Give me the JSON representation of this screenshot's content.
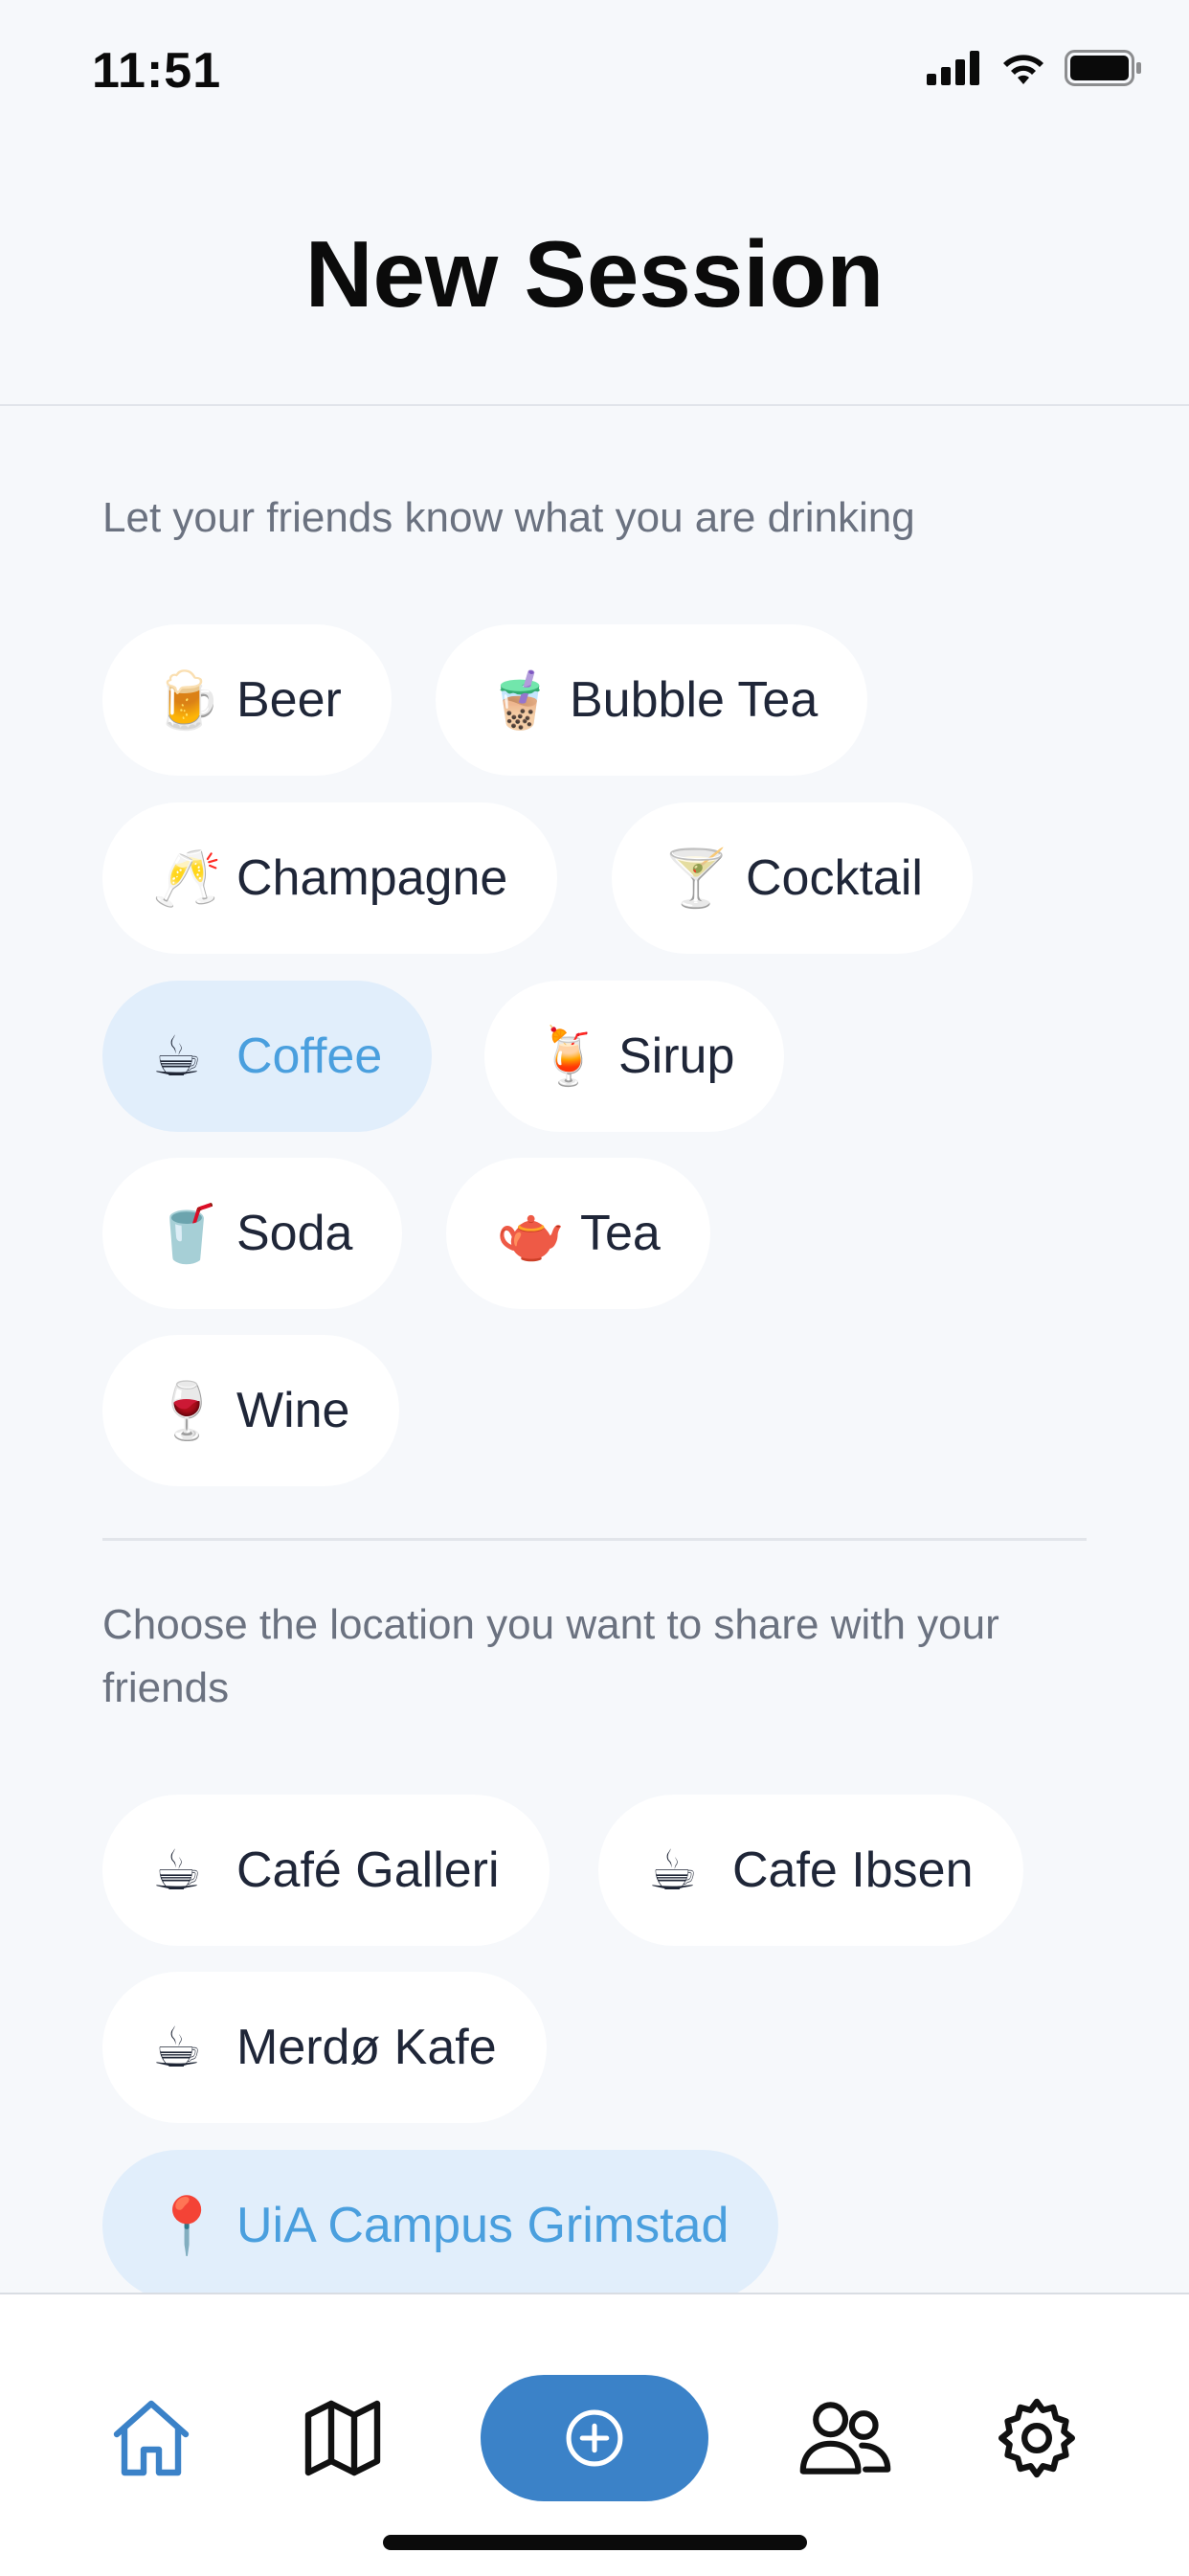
{
  "status": {
    "time": "11:51"
  },
  "header": {
    "title": "New Session"
  },
  "drinks": {
    "prompt": "Let your friends know what you are drinking",
    "items": [
      {
        "label": "Beer",
        "emoji": "🍺",
        "selected": false
      },
      {
        "label": "Bubble Tea",
        "emoji": "🧋",
        "selected": false
      },
      {
        "label": "Champagne",
        "emoji": "🥂",
        "selected": false
      },
      {
        "label": "Cocktail",
        "emoji": "🍸",
        "selected": false
      },
      {
        "label": "Coffee",
        "emoji": "☕",
        "selected": true
      },
      {
        "label": "Sirup",
        "emoji": "🍹",
        "selected": false
      },
      {
        "label": "Soda",
        "emoji": "🥤",
        "selected": false
      },
      {
        "label": "Tea",
        "emoji": "🫖",
        "selected": false
      },
      {
        "label": "Wine",
        "emoji": "🍷",
        "selected": false
      }
    ]
  },
  "locations": {
    "prompt": "Choose the location you want to share with your friends",
    "items": [
      {
        "label": "Café Galleri",
        "emoji": "☕",
        "selected": false
      },
      {
        "label": "Cafe Ibsen",
        "emoji": "☕",
        "selected": false
      },
      {
        "label": "Merdø Kafe",
        "emoji": "☕",
        "selected": false
      },
      {
        "label": "UiA Campus Grimstad",
        "emoji": "📍",
        "selected": true
      }
    ]
  },
  "tabbar": {
    "items": [
      "home-icon",
      "map-icon",
      "add-circle-icon",
      "friends-icon",
      "settings-icon"
    ],
    "active": "home-icon"
  },
  "colors": {
    "accent": "#3b82c8",
    "selected_bg": "#e1eefb",
    "selected_text": "#4a9fde",
    "background": "#f6f8fb"
  }
}
